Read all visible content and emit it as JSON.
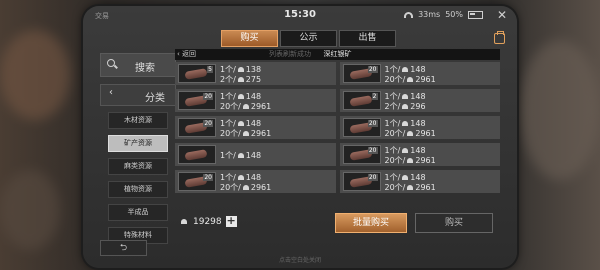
{
  "status": {
    "left": "交易",
    "time": "15:30",
    "net": "33ms",
    "battery": "50%"
  },
  "tabs": [
    {
      "label": "购买",
      "active": true
    },
    {
      "label": "公示",
      "active": false
    },
    {
      "label": "出售",
      "active": false
    }
  ],
  "sidebar": {
    "search_label": "搜索",
    "category_label": "分类",
    "categories": [
      {
        "label": "木材资源",
        "active": false
      },
      {
        "label": "矿产资源",
        "active": true
      },
      {
        "label": "麻类资源",
        "active": false
      },
      {
        "label": "植物资源",
        "active": false
      },
      {
        "label": "半成品",
        "active": false
      },
      {
        "label": "特殊材料",
        "active": false
      }
    ]
  },
  "breadcrumb": {
    "back": "返回",
    "faint": "列表刷新成功",
    "title": "深红银矿"
  },
  "items": [
    {
      "badge": "5",
      "line1_qty": "1个/",
      "line1_price": "138",
      "line2_qty": "2个/",
      "line2_price": "275"
    },
    {
      "badge": "20",
      "line1_qty": "1个/",
      "line1_price": "148",
      "line2_qty": "20个/",
      "line2_price": "2961"
    },
    {
      "badge": "20",
      "line1_qty": "1个/",
      "line1_price": "148",
      "line2_qty": "20个/",
      "line2_price": "2961"
    },
    {
      "badge": "2",
      "line1_qty": "1个/",
      "line1_price": "148",
      "line2_qty": "2个/",
      "line2_price": "296"
    },
    {
      "badge": "20",
      "line1_qty": "1个/",
      "line1_price": "148",
      "line2_qty": "20个/",
      "line2_price": "2961"
    },
    {
      "badge": "20",
      "line1_qty": "1个/",
      "line1_price": "148",
      "line2_qty": "20个/",
      "line2_price": "2961"
    },
    {
      "badge": "",
      "line1_qty": "1个/",
      "line1_price": "148",
      "line2_qty": "",
      "line2_price": ""
    },
    {
      "badge": "20",
      "line1_qty": "1个/",
      "line1_price": "148",
      "line2_qty": "20个/",
      "line2_price": "2961"
    },
    {
      "badge": "20",
      "line1_qty": "1个/",
      "line1_price": "148",
      "line2_qty": "20个/",
      "line2_price": "2961"
    },
    {
      "badge": "20",
      "line1_qty": "1个/",
      "line1_price": "148",
      "line2_qty": "20个/",
      "line2_price": "2961"
    }
  ],
  "bottom": {
    "money": "19298",
    "batch_buy": "批量购买",
    "buy": "购买"
  },
  "footer_faint": "点击空白处关闭"
}
